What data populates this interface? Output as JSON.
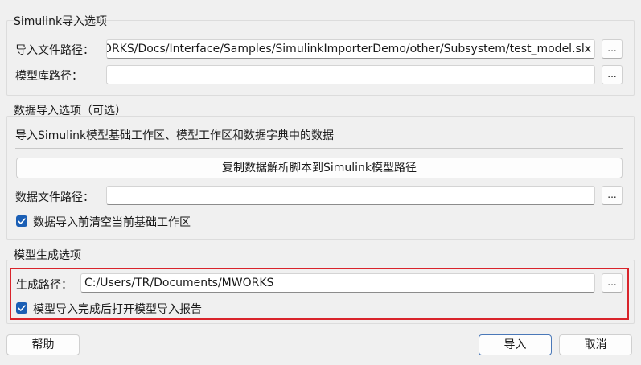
{
  "simulink": {
    "title": "Simulink导入选项",
    "import_path_label": "导入文件路径：",
    "import_path_value": "~/Documents/MWORKS/Docs/Interface/Samples/SimulinkImporterDemo/other/Subsystem/test_model.slx",
    "library_path_label": "模型库路径：",
    "library_path_value": "",
    "browse_label": "..."
  },
  "data": {
    "title": "数据导入选项（可选）",
    "description": "导入Simulink模型基础工作区、模型工作区和数据字典中的数据",
    "copy_script_label": "复制数据解析脚本到Simulink模型路径",
    "data_file_label": "数据文件路径：",
    "data_file_value": "",
    "clear_workspace_label": "数据导入前清空当前基础工作区",
    "clear_workspace_checked": true
  },
  "generate": {
    "title": "模型生成选项",
    "path_label": "生成路径：",
    "path_value": "C:/Users/TR/Documents/MWORKS",
    "open_report_label": "模型导入完成后打开模型导入报告",
    "open_report_checked": true,
    "highlight_color": "#d9242b"
  },
  "footer": {
    "help_label": "帮助",
    "import_label": "导入",
    "cancel_label": "取消"
  },
  "colors": {
    "checkbox": "#1b5fb5",
    "background": "#f0f0f0"
  }
}
